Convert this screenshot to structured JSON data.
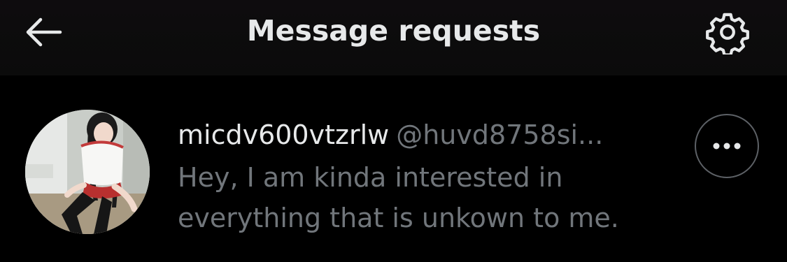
{
  "header": {
    "back_icon": "arrow-left-icon",
    "title": "Message requests",
    "settings_icon": "gear-icon"
  },
  "request": {
    "display_name": "micdv600vtzrlw",
    "handle": "@huvd8758si...",
    "message": "Hey, I am kinda interested in everything that is unkown to me.",
    "more_icon": "more-horizontal-icon"
  },
  "colors": {
    "background": "#000000",
    "header_background": "#0e0c0e",
    "primary_text": "#e7e9ea",
    "secondary_text": "#71767b",
    "border": "#5d6166"
  }
}
